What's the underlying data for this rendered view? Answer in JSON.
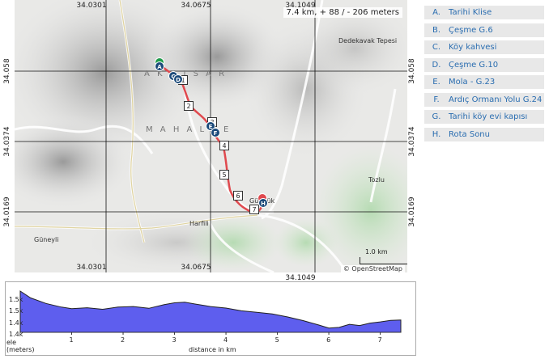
{
  "map": {
    "distance_summary": "7.4 km, + 88 / - 206 meters",
    "attribution": "© OpenStreetMap",
    "scale_label": "1.0 km",
    "grid_lon_labels": [
      "34.0301",
      "34.0675",
      "34.1049"
    ],
    "grid_lat_labels": [
      "34.058",
      "34.0374",
      "34.0169"
    ],
    "places": {
      "dedekavak": "Dedekavak Tepesi",
      "akhisar": "A K H I S A R",
      "mahalle": "M A H A L L E",
      "tozlu": "Tozlu",
      "gunduk": "Gündük",
      "harfili": "Harfili",
      "guneyli": "Güneyli"
    },
    "km_markers": [
      "1",
      "2",
      "3",
      "4",
      "5",
      "6",
      "7"
    ],
    "waypoint_letters": [
      "A",
      "B",
      "C",
      "D",
      "E",
      "F",
      "G",
      "H"
    ]
  },
  "legend": [
    {
      "letter": "A.",
      "label": "Tarihi Klise"
    },
    {
      "letter": "B.",
      "label": "Çeşme G.6"
    },
    {
      "letter": "C.",
      "label": "Köy kahvesi"
    },
    {
      "letter": "D.",
      "label": "Çeşme G.10"
    },
    {
      "letter": "E.",
      "label": "Mola - G.23"
    },
    {
      "letter": "F.",
      "label": "Ardıç Ormanı Yolu G.24"
    },
    {
      "letter": "G.",
      "label": "Tarihi köy evi kapısı"
    },
    {
      "letter": "H.",
      "label": "Rota Sonu"
    }
  ],
  "profile": {
    "y_axis_label_line1": "ele",
    "y_axis_label_line2": "(meters)",
    "x_axis_label": "distance in km",
    "y_ticks": [
      "1.5k",
      "1.5k",
      "1.4k",
      "1.4k"
    ],
    "x_ticks": [
      "1",
      "2",
      "3",
      "4",
      "5",
      "6",
      "7"
    ],
    "fill_color": "#5e5eee",
    "elevation_km": [
      0,
      0.2,
      0.5,
      0.8,
      1.0,
      1.3,
      1.6,
      1.9,
      2.2,
      2.5,
      2.8,
      3.0,
      3.2,
      3.4,
      3.7,
      4.0,
      4.3,
      4.6,
      4.9,
      5.2,
      5.5,
      5.8,
      6.0,
      6.2,
      6.4,
      6.6,
      6.8,
      7.0,
      7.2,
      7.4
    ],
    "elevation_m": [
      1552,
      1530,
      1512,
      1500,
      1495,
      1498,
      1493,
      1500,
      1502,
      1496,
      1508,
      1514,
      1516,
      1510,
      1502,
      1497,
      1488,
      1483,
      1478,
      1468,
      1456,
      1442,
      1432,
      1434,
      1444,
      1440,
      1448,
      1452,
      1457,
      1458
    ],
    "ylim": [
      1418,
      1560
    ],
    "xlim": [
      0,
      7.4
    ]
  }
}
